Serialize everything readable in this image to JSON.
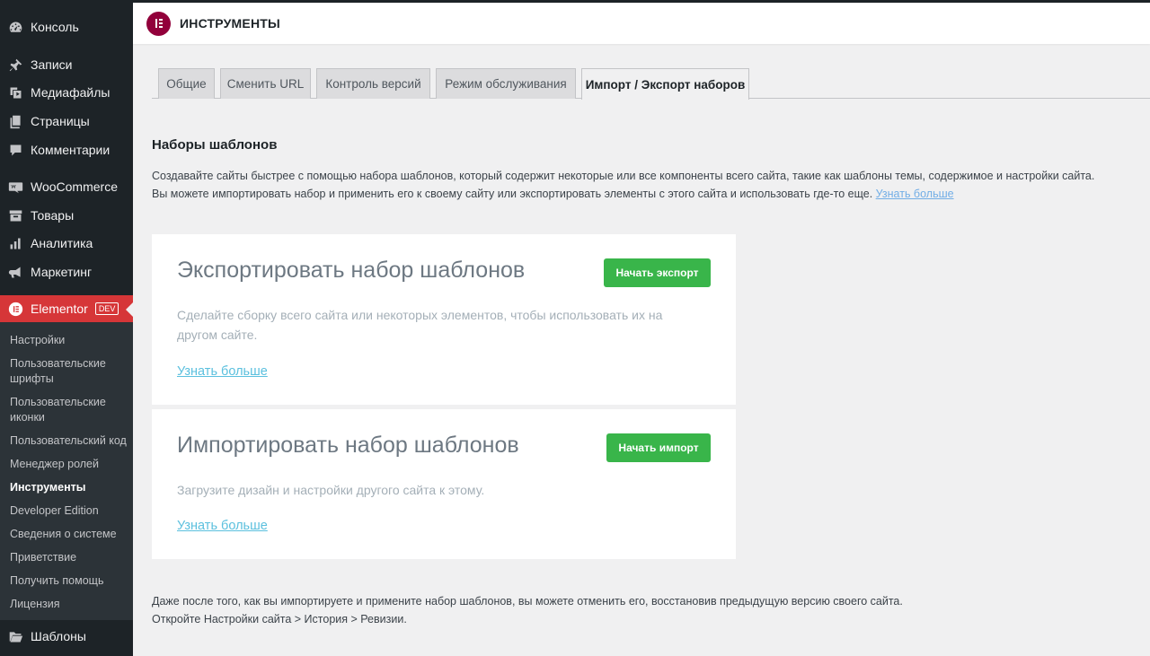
{
  "sidebar": {
    "items": [
      {
        "label": "Консоль",
        "icon": "dashboard-icon"
      },
      {
        "label": "Записи",
        "icon": "pin-icon"
      },
      {
        "label": "Медиафайлы",
        "icon": "media-icon"
      },
      {
        "label": "Страницы",
        "icon": "pages-icon"
      },
      {
        "label": "Комментарии",
        "icon": "comment-icon"
      },
      {
        "label": "WooCommerce",
        "icon": "woo-icon"
      },
      {
        "label": "Товары",
        "icon": "archive-icon"
      },
      {
        "label": "Аналитика",
        "icon": "chart-bar-icon"
      },
      {
        "label": "Маркетинг",
        "icon": "megaphone-icon"
      },
      {
        "label": "Elementor",
        "icon": "elementor-icon",
        "badge": "DEV"
      }
    ],
    "submenu": [
      "Настройки",
      "Пользовательские шрифты",
      "Пользовательские иконки",
      "Пользовательский код",
      "Менеджер ролей",
      "Инструменты",
      "Developer Edition",
      "Сведения о системе",
      "Приветствие",
      "Получить помощь",
      "Лицензия"
    ],
    "current_submenu": "Инструменты",
    "bottom_item": {
      "label": "Шаблоны",
      "icon": "folder-icon"
    }
  },
  "header": {
    "title": "ИНСТРУМЕНТЫ"
  },
  "tabs": [
    {
      "label": "Общие"
    },
    {
      "label": "Сменить URL"
    },
    {
      "label": "Контроль версий"
    },
    {
      "label": "Режим обслуживания"
    },
    {
      "label": "Импорт / Экспорт наборов"
    }
  ],
  "active_tab": "Импорт / Экспорт наборов",
  "kits": {
    "title": "Наборы шаблонов",
    "description_1": "Создавайте сайты быстрее с помощью набора шаблонов, который содержит некоторые или все компоненты всего сайта, такие как шаблоны темы, содержимое и настройки сайта.",
    "description_2": "Вы можете импортировать набор и применить его к своему сайту или экспортировать элементы с этого сайта и использовать где-то еще.",
    "learn_more": "Узнать больше"
  },
  "export_card": {
    "title": "Экспортировать набор шаблонов",
    "button": "Начать экспорт",
    "description": "Сделайте сборку всего сайта или некоторых элементов, чтобы использовать их на другом сайте.",
    "link": "Узнать больше"
  },
  "import_card": {
    "title": "Импортировать набор шаблонов",
    "button": "Начать импорт",
    "description": "Загрузите дизайн и настройки другого сайта к этому.",
    "link": "Узнать больше"
  },
  "footer": {
    "line1": "Даже после того, как вы импортируете и примените набор шаблонов, вы можете отменить его, восстановив предыдущую версию своего сайта.",
    "line2": "Откройте Настройки сайта > История > Ревизии."
  },
  "colors": {
    "accent_red": "#d63638",
    "brand": "#92003b",
    "green": "#39b54a",
    "link": "#5bc0de"
  }
}
